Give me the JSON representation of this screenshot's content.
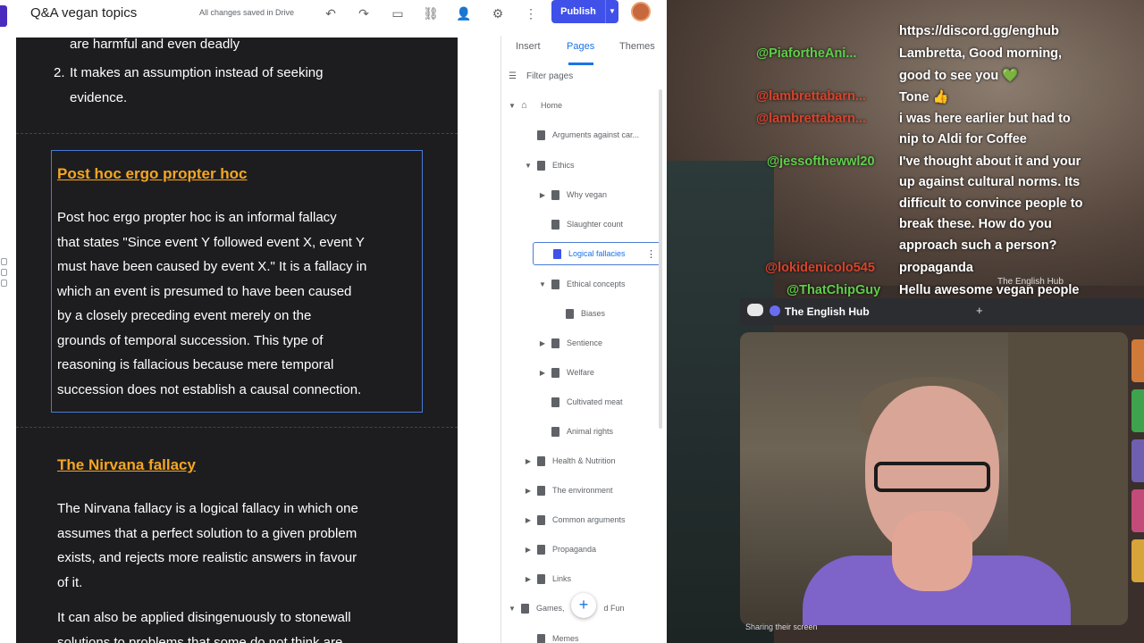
{
  "app": {
    "doc_title": "Q&A vegan topics",
    "save_status": "All changes saved in Drive",
    "publish_label": "Publish"
  },
  "canvas": {
    "list_tail": "are harmful and even deadly",
    "list_item_2_num": "2.",
    "list_item_2_line1": "It makes an assumption instead of seeking",
    "list_item_2_line2": "evidence.",
    "section1_title": "Post hoc ergo propter hoc",
    "section1_lines": [
      "Post hoc ergo propter hoc is an informal fallacy",
      "that states \"Since event Y followed event X, event Y",
      "must have been caused by event X.\" It is a fallacy in",
      "which an event is presumed to have been caused",
      "by a closely preceding event merely on the",
      "grounds of temporal succession. This type of",
      "reasoning is fallacious because mere temporal",
      "succession does not establish a causal connection."
    ],
    "section2_title": "The Nirvana fallacy",
    "section2_lines": [
      "The Nirvana fallacy is a logical fallacy in which one",
      "assumes that a perfect solution to a given problem",
      "exists, and rejects more realistic answers in favour",
      "of it."
    ],
    "section2_p2_lines": [
      "It can also be applied disingenuously to stonewall",
      "solutions to problems that some do not think are"
    ]
  },
  "panel": {
    "tabs": [
      "Insert",
      "Pages",
      "Themes"
    ],
    "filter_placeholder": "Filter pages",
    "pages": [
      {
        "label": "Home"
      },
      {
        "label": "Arguments against car..."
      },
      {
        "label": "Ethics"
      },
      {
        "label": "Why vegan"
      },
      {
        "label": "Slaughter count"
      },
      {
        "label": "Logical fallacies"
      },
      {
        "label": "Ethical concepts"
      },
      {
        "label": "Biases"
      },
      {
        "label": "Sentience"
      },
      {
        "label": "Welfare"
      },
      {
        "label": "Cultivated meat"
      },
      {
        "label": "Animal rights"
      },
      {
        "label": "Health & Nutrition"
      },
      {
        "label": "The environment"
      },
      {
        "label": "Common arguments"
      },
      {
        "label": "Propaganda"
      },
      {
        "label": "Links"
      },
      {
        "label": "Games,"
      },
      {
        "label": "d Fun"
      },
      {
        "label": "Memes"
      }
    ]
  },
  "stream": {
    "chat": [
      {
        "user": "",
        "msg": "https://discord.gg/enghub"
      },
      {
        "user": "@PiafortheAni...",
        "msg": "Lambretta, Good morning,"
      },
      {
        "user": "",
        "msg": "good to see you 💚"
      },
      {
        "user": "@lambrettabarn...",
        "msg": "Tone 👍"
      },
      {
        "user": "@lambrettabarn...",
        "msg": "i was here earlier but had to"
      },
      {
        "user": "",
        "msg": "nip to Aldi for Coffee"
      },
      {
        "user": "@jessofthewwl20",
        "msg": "I've thought about it and your"
      },
      {
        "user": "",
        "msg": "up against cultural norms. Its"
      },
      {
        "user": "",
        "msg": "difficult to convince people to"
      },
      {
        "user": "",
        "msg": "break these. How do you"
      },
      {
        "user": "",
        "msg": "approach such a person?"
      },
      {
        "user": "@lokidenicolo545",
        "msg": "propaganda"
      },
      {
        "user": "@ThatChipGuy",
        "msg": "Hellu awesome vegan people"
      }
    ],
    "hub_tag": "The English Hub",
    "discord_server": "The English Hub",
    "sharing_text": "Sharing their screen"
  },
  "colors": {
    "accent": "#3f51e8",
    "section_title": "#f5a623",
    "chat_user": "#5fce4a"
  }
}
